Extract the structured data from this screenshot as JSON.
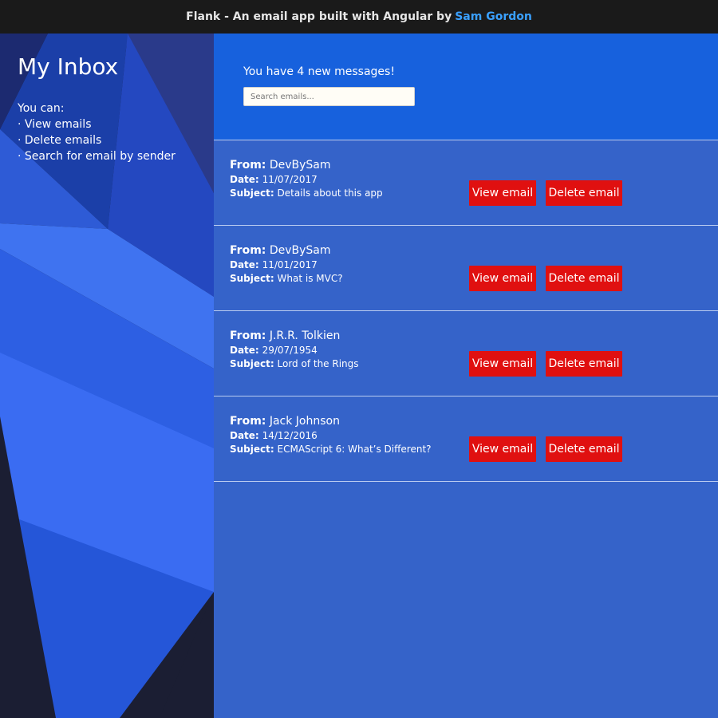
{
  "topbar": {
    "title": "Flank - An email app built with Angular by",
    "author": "Sam Gordon",
    "author_color": "#3aa0ff"
  },
  "sidebar": {
    "title": "My Inbox",
    "intro": "You can:",
    "items": [
      "View emails",
      "Delete emails",
      "Search for email by sender"
    ]
  },
  "header": {
    "count_text": "You have 4 new messages!",
    "search_placeholder": "Search emails..."
  },
  "labels": {
    "from": "From:",
    "date": "Date:",
    "subject": "Subject:",
    "view": "View email",
    "delete": "Delete email"
  },
  "emails": [
    {
      "from": "DevBySam",
      "date": "11/07/2017",
      "subject": "Details about this app"
    },
    {
      "from": "DevBySam",
      "date": "11/01/2017",
      "subject": "What is MVC?"
    },
    {
      "from": "J.R.R. Tolkien",
      "date": "29/07/1954",
      "subject": "Lord of the Rings"
    },
    {
      "from": "Jack Johnson",
      "date": "14/12/2016",
      "subject": "ECMAScript 6: What’s Different?"
    }
  ],
  "colors": {
    "topbar_bg": "#1a1a1a",
    "header_bg": "#1761dd",
    "list_bg": "#3563c9",
    "button_red": "#e01010"
  }
}
